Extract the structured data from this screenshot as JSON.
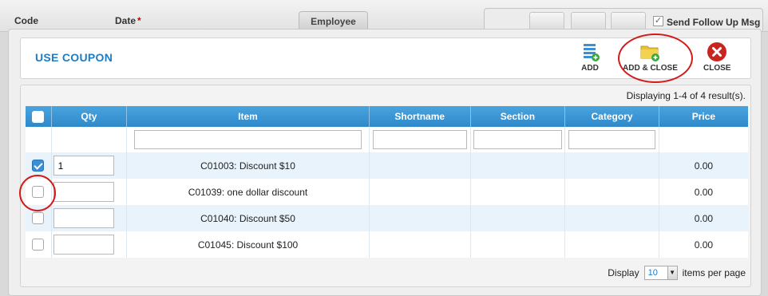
{
  "background": {
    "labels": {
      "code": "Code",
      "date": "Date",
      "date_required": "*"
    },
    "tab_employee": "Employee",
    "send_follow_up_label": "Send Follow Up Msg",
    "send_follow_up_checked": true
  },
  "dialog": {
    "title": "USE COUPON",
    "toolbar": {
      "add_label": "ADD",
      "add_close_label": "ADD & CLOSE",
      "close_label": "CLOSE"
    },
    "result_info": "Displaying 1-4 of 4 result(s).",
    "columns": [
      "Qty",
      "Item",
      "Shortname",
      "Section",
      "Category",
      "Price"
    ],
    "rows": [
      {
        "checked": true,
        "qty": "1",
        "item": "C01003: Discount $10",
        "shortname": "",
        "section": "",
        "category": "",
        "price": "0.00"
      },
      {
        "checked": false,
        "qty": "",
        "item": "C01039: one dollar discount",
        "shortname": "",
        "section": "",
        "category": "",
        "price": "0.00"
      },
      {
        "checked": false,
        "qty": "",
        "item": "C01040: Discount $50",
        "shortname": "",
        "section": "",
        "category": "",
        "price": "0.00"
      },
      {
        "checked": false,
        "qty": "",
        "item": "C01045: Discount $100",
        "shortname": "",
        "section": "",
        "category": "",
        "price": "0.00"
      }
    ],
    "pager": {
      "display_label": "Display",
      "per_page_value": "10",
      "items_label": "items per page"
    }
  },
  "colors": {
    "accent": "#1d7cc4",
    "header_blue": "#3a93d3",
    "annotation_red": "#d21a1a",
    "close_red": "#c9241f",
    "add_green": "#3aa83a"
  },
  "icons": [
    "list-add-icon",
    "folder-add-icon",
    "close-circle-icon",
    "dropdown-arrow-icon"
  ]
}
